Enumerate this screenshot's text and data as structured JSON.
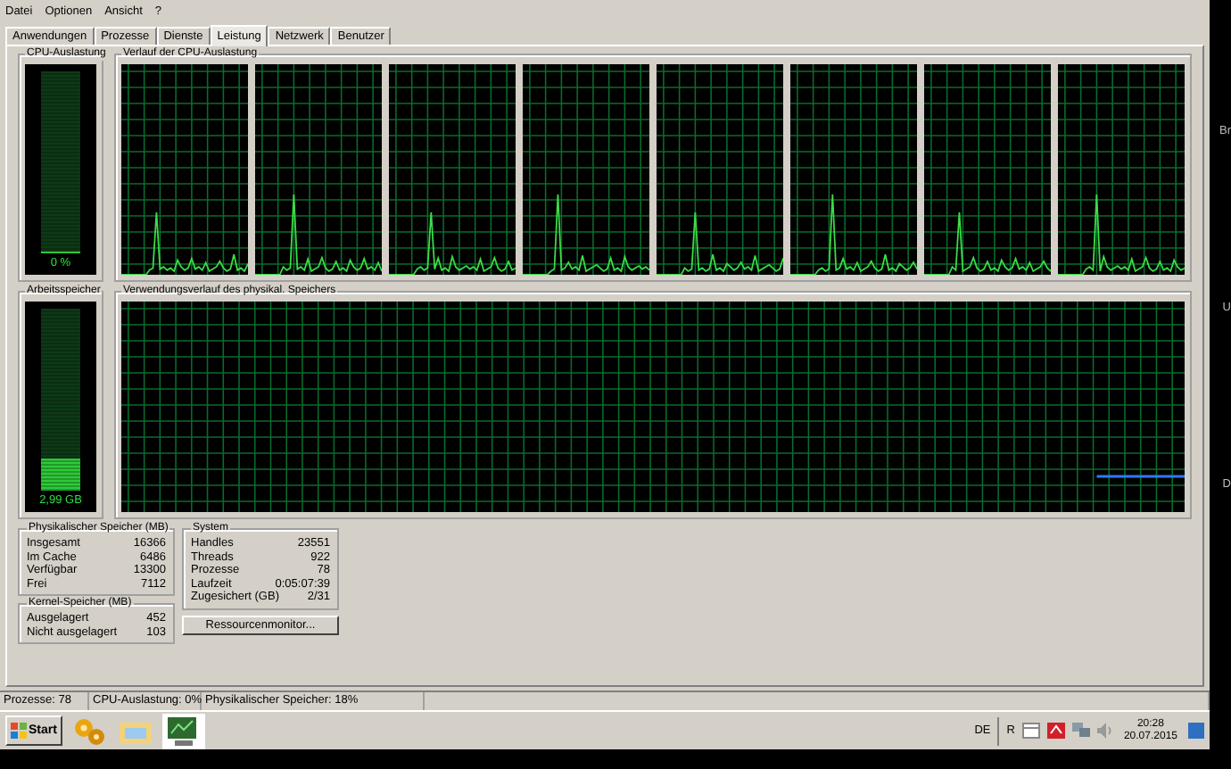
{
  "menu": [
    "Datei",
    "Optionen",
    "Ansicht",
    "?"
  ],
  "tabs": [
    {
      "label": "Anwendungen",
      "selected": false
    },
    {
      "label": "Prozesse",
      "selected": false
    },
    {
      "label": "Dienste",
      "selected": false
    },
    {
      "label": "Leistung",
      "selected": true
    },
    {
      "label": "Netzwerk",
      "selected": false
    },
    {
      "label": "Benutzer",
      "selected": false
    }
  ],
  "cpu_usage": {
    "title": "CPU-Auslastung",
    "level": 0,
    "reading": "0 %"
  },
  "cpu_history": {
    "title": "Verlauf der CPU-Auslastung"
  },
  "memory": {
    "title": "Arbeitsspeicher",
    "level": 0.18,
    "reading": "2,99 GB"
  },
  "memory_history": {
    "title": "Verwendungsverlauf des physikal. Speichers"
  },
  "physical_memory": {
    "title": "Physikalischer Speicher (MB)",
    "rows": [
      {
        "label": "Insgesamt",
        "value": "16366"
      },
      {
        "label": "Im Cache",
        "value": "6486"
      },
      {
        "label": "Verfügbar",
        "value": "13300"
      },
      {
        "label": "Frei",
        "value": "7112"
      }
    ]
  },
  "kernel_memory": {
    "title": "Kernel-Speicher (MB)",
    "rows": [
      {
        "label": "Ausgelagert",
        "value": "452"
      },
      {
        "label": "Nicht ausgelagert",
        "value": "103"
      }
    ]
  },
  "system": {
    "title": "System",
    "rows": [
      {
        "label": "Handles",
        "value": "23551"
      },
      {
        "label": "Threads",
        "value": "922"
      },
      {
        "label": "Prozesse",
        "value": "78"
      },
      {
        "label": "Laufzeit",
        "value": "0:05:07:39"
      },
      {
        "label": "Zugesichert (GB)",
        "value": "2/31"
      }
    ]
  },
  "resource_button": "Ressourcenmonitor...",
  "status_bar": [
    "Prozesse: 78",
    "CPU-Auslastung: 0%",
    "Physikalischer Speicher: 18%"
  ],
  "taskbar": {
    "start": "Start",
    "language": "DE",
    "tray_letter": "R",
    "time": "20:28",
    "date": "20.07.2015"
  },
  "background_text": [
    "Br",
    "U",
    "D"
  ]
}
